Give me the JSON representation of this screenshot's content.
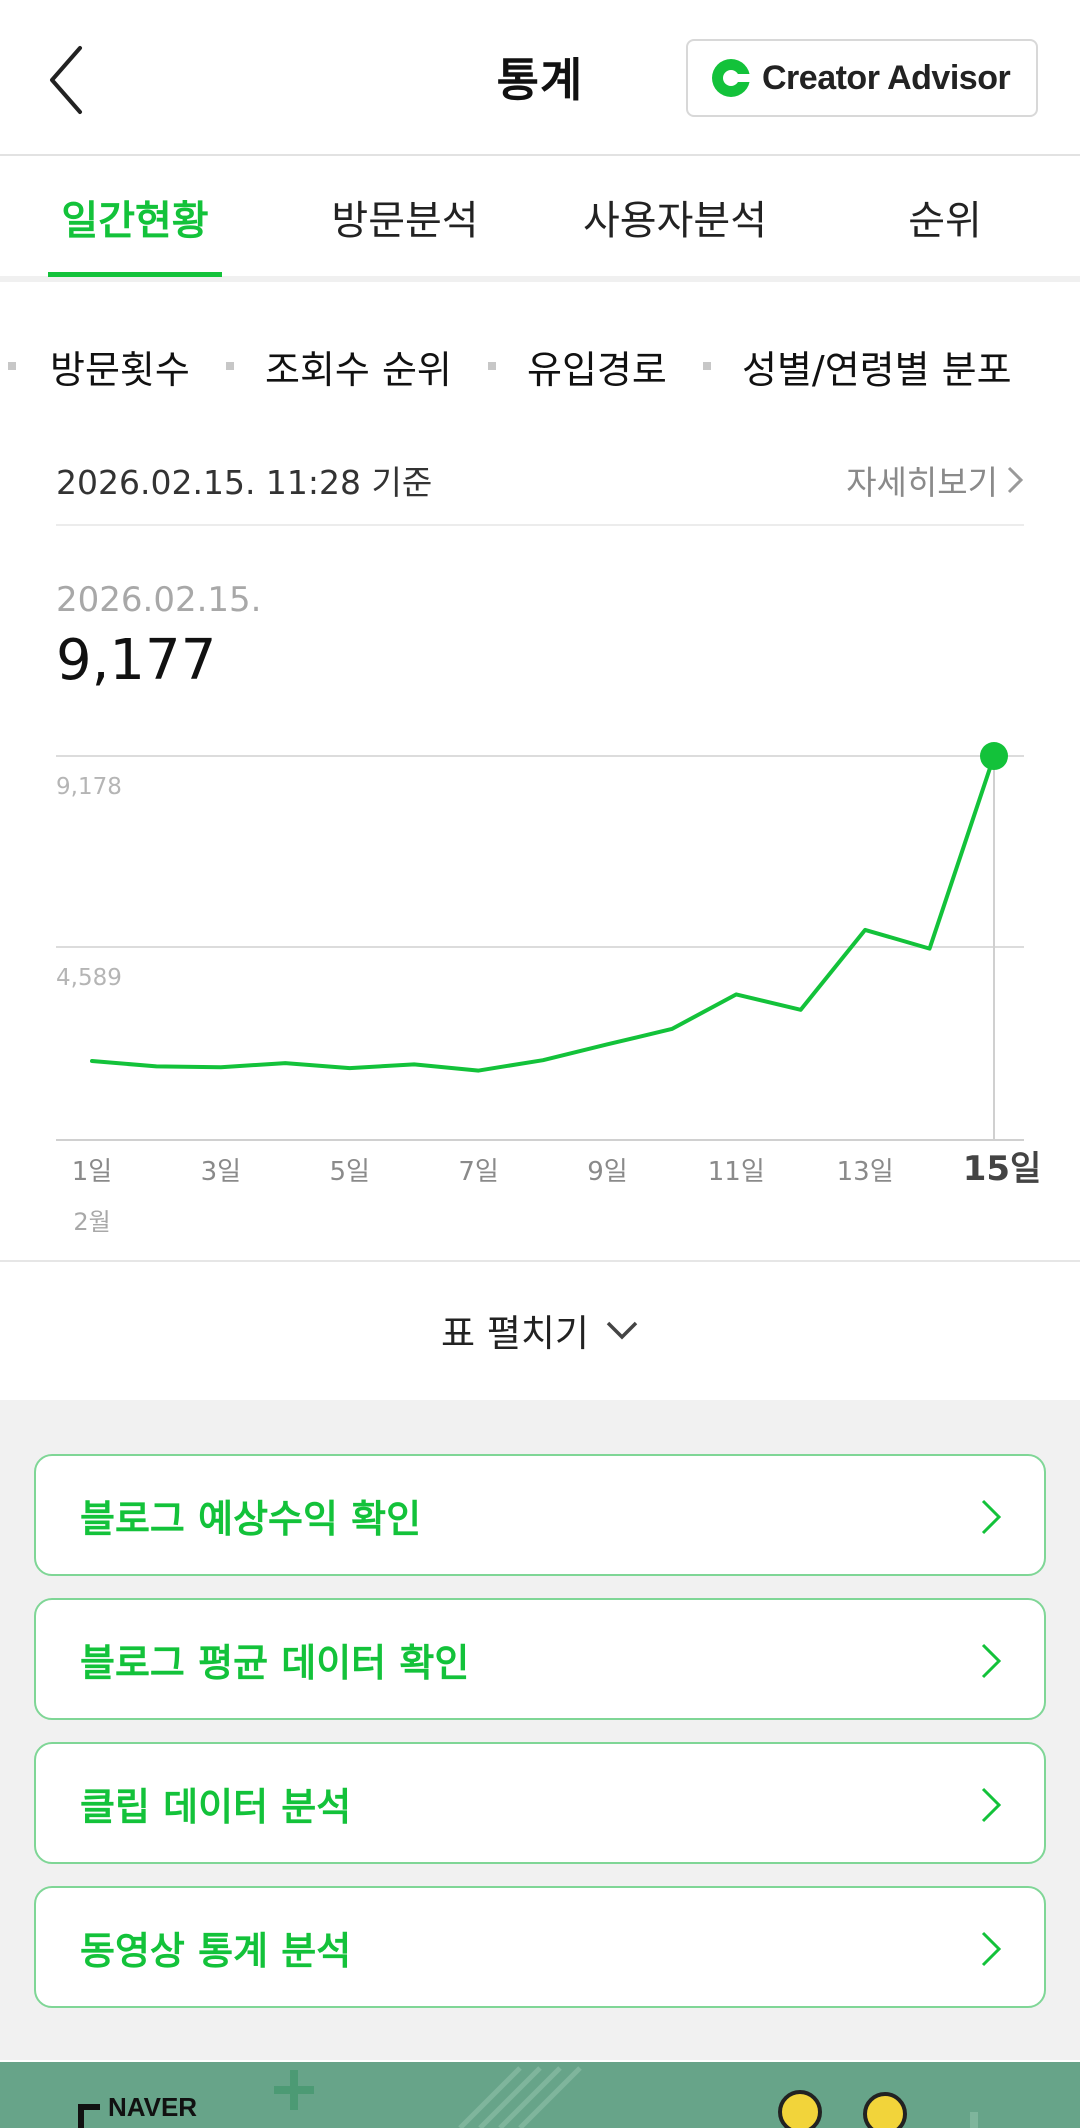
{
  "header": {
    "title": "통계",
    "creator_advisor_label": "Creator Advisor",
    "accent": "#13c23a"
  },
  "tabs": [
    {
      "label": "일간현황",
      "active": true
    },
    {
      "label": "방문분석",
      "active": false
    },
    {
      "label": "사용자분석",
      "active": false
    },
    {
      "label": "순위",
      "active": false
    }
  ],
  "subtabs": [
    "방문횟수",
    "조회수 순위",
    "유입경로",
    "성별/연령별 분포"
  ],
  "summary": {
    "updated_at": "2026.02.15. 11:28 기준",
    "detail_link": "자세히보기",
    "selected_date": "2026.02.15.",
    "selected_value": "9,177"
  },
  "chart_data": {
    "type": "line",
    "x": [
      1,
      2,
      3,
      4,
      5,
      6,
      7,
      8,
      9,
      10,
      11,
      12,
      13,
      14,
      15
    ],
    "values": [
      1850,
      1720,
      1700,
      1800,
      1680,
      1770,
      1620,
      1870,
      2250,
      2620,
      3450,
      3080,
      5000,
      4550,
      9177
    ],
    "x_tick_labels": [
      "1일",
      "3일",
      "5일",
      "7일",
      "9일",
      "11일",
      "13일",
      "15일"
    ],
    "x_tick_values": [
      1,
      3,
      5,
      7,
      9,
      11,
      13,
      15
    ],
    "month_label": "2월",
    "y_tick_labels": [
      "9,178",
      "4,589"
    ],
    "y_tick_values": [
      9178,
      4589
    ],
    "ylim": [
      0,
      9178
    ],
    "highlight_x": 15,
    "line_color": "#13c23a",
    "grid": true
  },
  "expand_table_label": "표 펼치기",
  "cards": [
    {
      "label": "블로그 예상수익 확인"
    },
    {
      "label": "블로그 평균 데이터 확인"
    },
    {
      "label": "클립 데이터 분석"
    },
    {
      "label": "동영상 통계 분석"
    }
  ],
  "banner": {
    "text": "NAVER",
    "color": "#67a489"
  }
}
